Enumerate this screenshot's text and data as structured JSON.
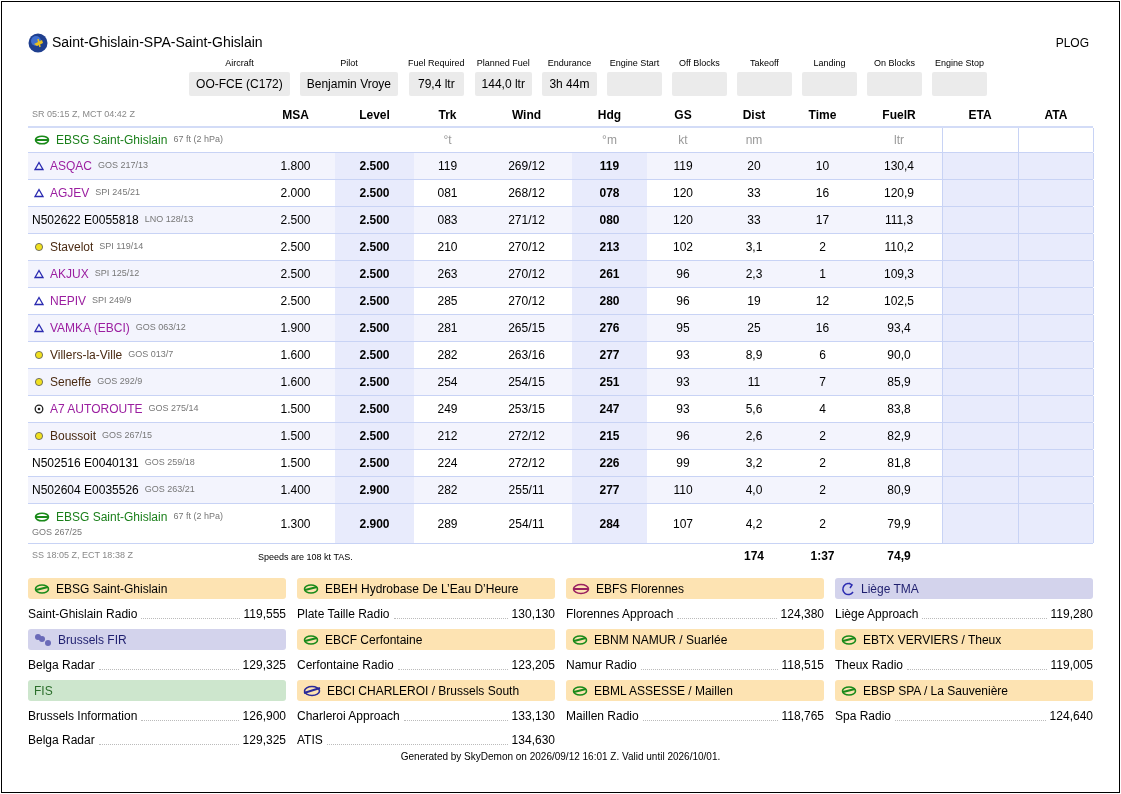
{
  "title": "Saint-Ghislain-SPA-Saint-Ghislain",
  "document_type": "PLOG",
  "info_fields": [
    {
      "label": "Aircraft",
      "value": "OO-FCE (C172)"
    },
    {
      "label": "Pilot",
      "value": "Benjamin Vroye"
    },
    {
      "label": "Fuel Required",
      "value": "79,4 ltr"
    },
    {
      "label": "Planned Fuel",
      "value": "144,0 ltr"
    },
    {
      "label": "Endurance",
      "value": "3h 44m"
    },
    {
      "label": "Engine Start"
    },
    {
      "label": "Off Blocks"
    },
    {
      "label": "Takeoff"
    },
    {
      "label": "Landing"
    },
    {
      "label": "On Blocks"
    },
    {
      "label": "Engine Stop"
    }
  ],
  "table": {
    "sun_note": "SR 05:15 Z, MCT 04:42 Z",
    "columns": [
      {
        "label": "MSA"
      },
      {
        "label": "Level"
      },
      {
        "label": "Trk",
        "unit": "°t"
      },
      {
        "label": "Wind"
      },
      {
        "label": "Hdg",
        "unit": "°m"
      },
      {
        "label": "GS",
        "unit": "kt"
      },
      {
        "label": "Dist",
        "unit": "nm"
      },
      {
        "label": "Time"
      },
      {
        "label": "FuelR",
        "unit": "ltr"
      },
      {
        "label": "ETA"
      },
      {
        "label": "ATA"
      }
    ],
    "departure": {
      "kind": "airfield",
      "name": "EBSG Saint-Ghislain",
      "elevation": "67 ft (2 hPa)"
    },
    "rows": [
      {
        "kind": "reporting-point",
        "name": "ASQAC",
        "ref": "GOS 217/13",
        "cells": [
          "1.800",
          "2.500",
          "119",
          "269/12",
          "119",
          "119",
          "20",
          "10",
          "130,4"
        ]
      },
      {
        "kind": "reporting-point",
        "name": "AGJEV",
        "ref": "SPI 245/21",
        "cells": [
          "2.000",
          "2.500",
          "081",
          "268/12",
          "078",
          "120",
          "33",
          "16",
          "120,9"
        ]
      },
      {
        "kind": "coordinate",
        "name": "N502622 E0055818",
        "ref": "LNO 128/13",
        "cells": [
          "2.500",
          "2.500",
          "083",
          "271/12",
          "080",
          "120",
          "33",
          "17",
          "111,3"
        ]
      },
      {
        "kind": "vrp",
        "name": "Stavelot",
        "ref": "SPI 119/14",
        "cells": [
          "2.500",
          "2.500",
          "210",
          "270/12",
          "213",
          "102",
          "3,1",
          "2",
          "110,2"
        ]
      },
      {
        "kind": "reporting-point",
        "name": "AKJUX",
        "ref": "SPI 125/12",
        "cells": [
          "2.500",
          "2.500",
          "263",
          "270/12",
          "261",
          "96",
          "2,3",
          "1",
          "109,3"
        ]
      },
      {
        "kind": "reporting-point",
        "name": "NEPIV",
        "ref": "SPI 249/9",
        "cells": [
          "2.500",
          "2.500",
          "285",
          "270/12",
          "280",
          "96",
          "19",
          "12",
          "102,5"
        ]
      },
      {
        "kind": "reporting-point",
        "name": "VAMKA (EBCI)",
        "ref": "GOS 063/12",
        "cells": [
          "1.900",
          "2.500",
          "281",
          "265/15",
          "276",
          "95",
          "25",
          "16",
          "93,4"
        ]
      },
      {
        "kind": "vrp",
        "name": "Villers-la-Ville",
        "ref": "GOS 013/7",
        "cells": [
          "1.600",
          "2.500",
          "282",
          "263/16",
          "277",
          "93",
          "8,9",
          "6",
          "90,0"
        ]
      },
      {
        "kind": "vrp",
        "name": "Seneffe",
        "ref": "GOS 292/9",
        "cells": [
          "1.600",
          "2.500",
          "254",
          "254/15",
          "251",
          "93",
          "11",
          "7",
          "85,9"
        ]
      },
      {
        "kind": "landmark",
        "name": "A7 AUTOROUTE",
        "ref": "GOS 275/14",
        "cells": [
          "1.500",
          "2.500",
          "249",
          "253/15",
          "247",
          "93",
          "5,6",
          "4",
          "83,8"
        ]
      },
      {
        "kind": "vrp",
        "name": "Boussoit",
        "ref": "GOS 267/15",
        "cells": [
          "1.500",
          "2.500",
          "212",
          "272/12",
          "215",
          "96",
          "2,6",
          "2",
          "82,9"
        ]
      },
      {
        "kind": "coordinate",
        "name": "N502516 E0040131",
        "ref": "GOS 259/18",
        "cells": [
          "1.500",
          "2.500",
          "224",
          "272/12",
          "226",
          "99",
          "3,2",
          "2",
          "81,8"
        ]
      },
      {
        "kind": "coordinate",
        "name": "N502604 E0035526",
        "ref": "GOS 263/21",
        "cells": [
          "1.400",
          "2.900",
          "282",
          "255/11",
          "277",
          "110",
          "4,0",
          "2",
          "80,9"
        ]
      },
      {
        "kind": "airfield",
        "name": "EBSG Saint-Ghislain",
        "elevation": "67 ft (2 hPa)",
        "ref": "GOS 267/25",
        "cells": [
          "1.300",
          "2.900",
          "289",
          "254/11",
          "284",
          "107",
          "4,2",
          "2",
          "79,9"
        ]
      }
    ],
    "totals": {
      "sun_note": "SS 18:05 Z, ECT 18:38 Z",
      "note": "Speeds are 108 kt TAS.",
      "dist": "174",
      "time": "1:37",
      "fuelr": "74,9"
    }
  },
  "frequency_columns": [
    [
      {
        "kind": "airfield",
        "title": "EBSG Saint-Ghislain",
        "frequencies": [
          {
            "name": "Saint-Ghislain Radio",
            "freq": "119,555"
          }
        ]
      },
      {
        "kind": "fir",
        "title": "Brussels FIR",
        "frequencies": [
          {
            "name": "Belga Radar",
            "freq": "129,325"
          }
        ]
      },
      {
        "kind": "fis",
        "title": "FIS",
        "frequencies": [
          {
            "name": "Brussels Information",
            "freq": "126,900"
          },
          {
            "name": "Belga Radar",
            "freq": "129,325"
          }
        ]
      }
    ],
    [
      {
        "kind": "airfield",
        "title": "EBEH Hydrobase De L’Eau D’Heure",
        "frequencies": [
          {
            "name": "Plate Taille Radio",
            "freq": "130,130"
          }
        ]
      },
      {
        "kind": "airfield",
        "title": "EBCF Cerfontaine",
        "frequencies": [
          {
            "name": "Cerfontaine Radio",
            "freq": "123,205"
          }
        ]
      },
      {
        "kind": "airport",
        "title": "EBCI CHARLEROI / Brussels South",
        "frequencies": [
          {
            "name": "Charleroi Approach",
            "freq": "133,130"
          },
          {
            "name": "ATIS",
            "freq": "134,630"
          }
        ]
      }
    ],
    [
      {
        "kind": "military",
        "title": "EBFS Florennes",
        "frequencies": [
          {
            "name": "Florennes Approach",
            "freq": "124,380"
          }
        ]
      },
      {
        "kind": "airfield",
        "title": "EBNM NAMUR / Suarlée",
        "frequencies": [
          {
            "name": "Namur Radio",
            "freq": "118,515"
          }
        ]
      },
      {
        "kind": "airfield",
        "title": "EBML ASSESSE / Maillen",
        "frequencies": [
          {
            "name": "Maillen Radio",
            "freq": "118,765"
          }
        ]
      }
    ],
    [
      {
        "kind": "tma",
        "title": "Liège TMA",
        "frequencies": [
          {
            "name": "Liège Approach",
            "freq": "119,280"
          }
        ]
      },
      {
        "kind": "airfield",
        "title": "EBTX VERVIERS / Theux",
        "frequencies": [
          {
            "name": "Theux Radio",
            "freq": "119,005"
          }
        ]
      },
      {
        "kind": "airfield",
        "title": "EBSP SPA / La Sauvenière",
        "frequencies": [
          {
            "name": "Spa Radio",
            "freq": "124,640"
          }
        ]
      }
    ]
  ],
  "generated_note": "Generated by SkyDemon on 2026/09/12 16:01 Z. Valid until 2026/10/01."
}
